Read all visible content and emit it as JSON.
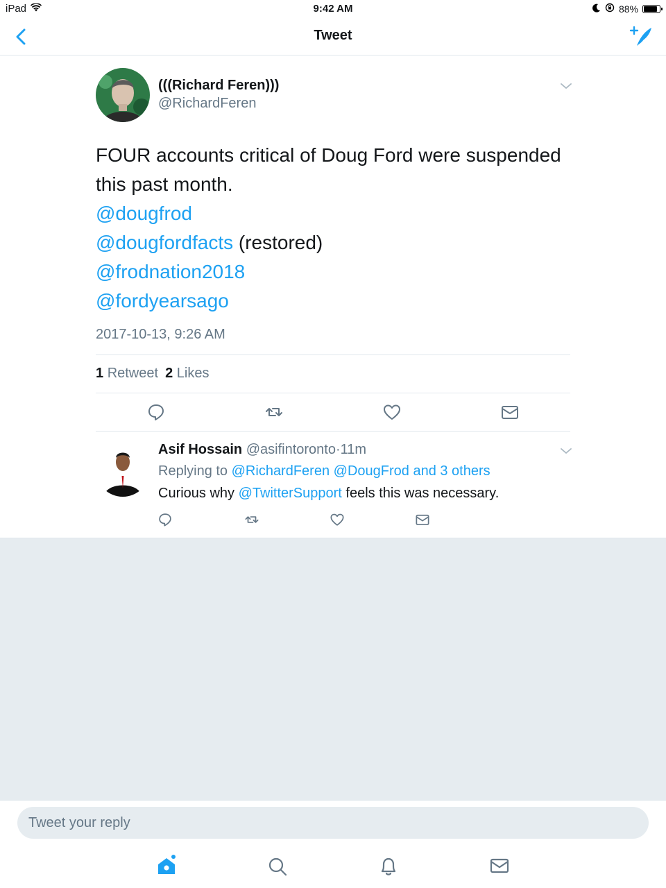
{
  "status_bar": {
    "device": "iPad",
    "time": "9:42 AM",
    "battery_percent": "88%",
    "battery_level": 0.88
  },
  "nav": {
    "title": "Tweet",
    "back_icon": "chevron-left-icon",
    "compose_icon": "compose-tweet-icon"
  },
  "tweet": {
    "author_name": "(((Richard Feren)))",
    "author_handle": "@RichardFeren",
    "text_line1": "FOUR accounts critical of Doug Ford were suspended",
    "text_line2": "this past month.",
    "mention1": "@dougfrod",
    "mention2": "@dougfordfacts",
    "mention2_suffix": " (restored)",
    "mention3": "@frodnation2018",
    "mention4": "@fordyearsago",
    "timestamp": "2017-10-13, 9:26 AM",
    "retweet_count": "1",
    "retweet_label": "Retweet",
    "like_count": "2",
    "like_label": "Likes"
  },
  "reply": {
    "name": "Asif Hossain",
    "handle": "@asifintoronto",
    "separator": "·",
    "age": "11m",
    "replying_to_label": "Replying to",
    "replying_to_users": "@RichardFeren @DougFrod and 3 others",
    "text_before": "Curious why ",
    "text_mention": "@TwitterSupport",
    "text_after": " feels this was necessary."
  },
  "composer": {
    "placeholder": "Tweet your reply"
  },
  "tabs": [
    "home-icon",
    "search-icon",
    "notifications-icon",
    "messages-icon"
  ],
  "colors": {
    "accent": "#1da1f2",
    "secondary_text": "#657786",
    "background_gray": "#e6ecf0"
  }
}
